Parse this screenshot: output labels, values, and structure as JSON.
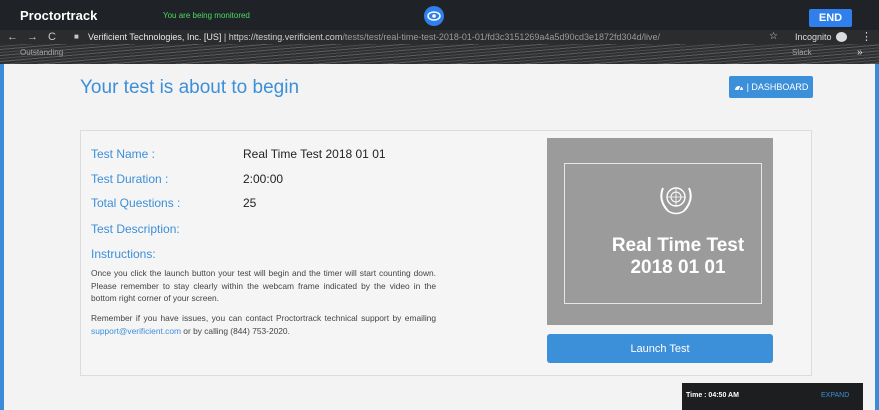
{
  "proctor": {
    "brand": "Proctortrack",
    "status": "You are being monitored",
    "end_label": "END"
  },
  "browser": {
    "back": "←",
    "forward": "→",
    "reload": "C",
    "lock": "■",
    "org": "Verificient Technologies, Inc. [US]",
    "url_host": "https://testing.verificient.com",
    "url_path": "/tests/test/real-time-test-2018-01-01/fd3c3151269a4a5d90cd3e1872fd304d/live/",
    "incognito": "Incognito",
    "menu": "⋮"
  },
  "bookmarks": {
    "items": [
      "Outstanding",
      "Slack"
    ],
    "more": "»"
  },
  "header": {
    "title": "Your test is about to begin",
    "dashboard_label": "| DASHBOARD"
  },
  "test": {
    "name_label": "Test Name :",
    "name_value": "Real Time Test 2018 01 01",
    "duration_label": "Test Duration :",
    "duration_value": "2:00:00",
    "questions_label": "Total Questions :",
    "questions_value": "25",
    "description_label": "Test Description:",
    "instructions_label": "Instructions:",
    "instructions_text": "Once you click the launch button your test will begin and the timer will start counting down. Please remember to stay clearly within the webcam frame indicated by the video in the bottom right corner of your screen.",
    "support_text_1": "Remember if you have issues, you can contact Proctortrack technical support by emailing ",
    "support_email": "support@verificient.com",
    "support_text_2": " or by calling (844) 753-2020."
  },
  "preview": {
    "line1": "Real Time Test",
    "line2": "2018 01 01"
  },
  "launch_label": "Launch Test",
  "timer": {
    "text": "Time : 04:50 AM",
    "expand_label": "EXPAND"
  },
  "colors": {
    "accent": "#3c8fd9",
    "monitor_green": "#4cd964",
    "dark_bar": "#1f2327"
  }
}
